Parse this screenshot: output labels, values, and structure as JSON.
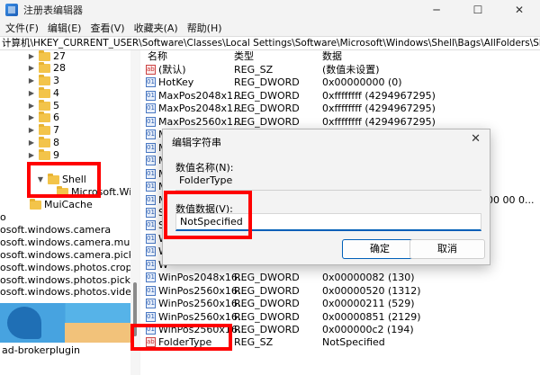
{
  "window": {
    "title": "注册表编辑器",
    "min_glyph": "─",
    "max_glyph": "☐",
    "close_glyph": "✕"
  },
  "menu": [
    "文件(F)",
    "编辑(E)",
    "查看(V)",
    "收藏夹(A)",
    "帮助(H)"
  ],
  "address": "计算机\\HKEY_CURRENT_USER\\Software\\Classes\\Local Settings\\Software\\Microsoft\\Windows\\Shell\\Bags\\AllFolders\\Shell",
  "tree": {
    "folders": [
      "27",
      "28",
      "3",
      "4",
      "5",
      "6",
      "7",
      "8",
      "9"
    ],
    "shell": "Shell",
    "shell_child": "Microsoft.Wi",
    "muicache": "MuiCache",
    "cut_items": [
      "o",
      "osoft.windows.camera",
      "osoft.windows.camera.multipicl",
      "osoft.windows.camera.picker",
      "osoft.windows.photos.crop",
      "osoft.windows.photos.picker",
      "osoft.windows.photos.videoedi"
    ],
    "bottom_item": "ad-brokerplugin"
  },
  "list": {
    "headers": {
      "name": "名称",
      "type": "类型",
      "data": "数据"
    },
    "rows": [
      {
        "name": "(默认)",
        "type": "REG_SZ",
        "data": "(数值未设置)",
        "kind": "sz"
      },
      {
        "name": "HotKey",
        "type": "REG_DWORD",
        "data": "0x00000000 (0)",
        "kind": "dw"
      },
      {
        "name": "MaxPos2048x1...",
        "type": "REG_DWORD",
        "data": "0xffffffff (4294967295)",
        "kind": "dw"
      },
      {
        "name": "MaxPos2048x1...",
        "type": "REG_DWORD",
        "data": "0xffffffff (4294967295)",
        "kind": "dw"
      },
      {
        "name": "MaxPos2560x1...",
        "type": "REG_DWORD",
        "data": "0xffffffff (4294967295)",
        "kind": "dw"
      },
      {
        "name": "Ma",
        "type": "",
        "data": "",
        "kind": "dw"
      },
      {
        "name": "Mi",
        "type": "",
        "data": "",
        "kind": "dw"
      },
      {
        "name": "Mi",
        "type": "",
        "data": "",
        "kind": "dw"
      },
      {
        "name": "Mi",
        "type": "",
        "data": "",
        "kind": "dw"
      },
      {
        "name": "Mi",
        "type": "",
        "data": "",
        "kind": "dw"
      },
      {
        "name": "M",
        "type": "",
        "data": "00 00 0...",
        "kind": "dw"
      },
      {
        "name": "S",
        "type": "",
        "data": "",
        "kind": "dw"
      },
      {
        "name": "S",
        "type": "",
        "data": "",
        "kind": "dw"
      },
      {
        "name": "W",
        "type": "",
        "data": "",
        "kind": "dw"
      },
      {
        "name": "W",
        "type": "",
        "data": "",
        "kind": "dw"
      },
      {
        "name": "W",
        "type": "",
        "data": "",
        "kind": "dw"
      },
      {
        "name": "WinPos2048x16...",
        "type": "REG_DWORD",
        "data": "0x00000082 (130)",
        "kind": "dw"
      },
      {
        "name": "WinPos2560x16...",
        "type": "REG_DWORD",
        "data": "0x00000520 (1312)",
        "kind": "dw"
      },
      {
        "name": "WinPos2560x16...",
        "type": "REG_DWORD",
        "data": "0x00000211 (529)",
        "kind": "dw"
      },
      {
        "name": "WinPos2560x16...",
        "type": "REG_DWORD",
        "data": "0x00000851 (2129)",
        "kind": "dw"
      },
      {
        "name": "WinPos2560x16...",
        "type": "REG_DWORD",
        "data": "0x000000c2 (194)",
        "kind": "dw"
      },
      {
        "name": "FolderType",
        "type": "REG_SZ",
        "data": "NotSpecified",
        "kind": "sz"
      }
    ]
  },
  "dialog": {
    "title": "编辑字符串",
    "close_glyph": "✕",
    "name_label": "数值名称(N):",
    "name_value": "FolderType",
    "data_label": "数值数据(V):",
    "data_value": "NotSpecified",
    "ok_label": "确定",
    "cancel_label": "取消"
  }
}
